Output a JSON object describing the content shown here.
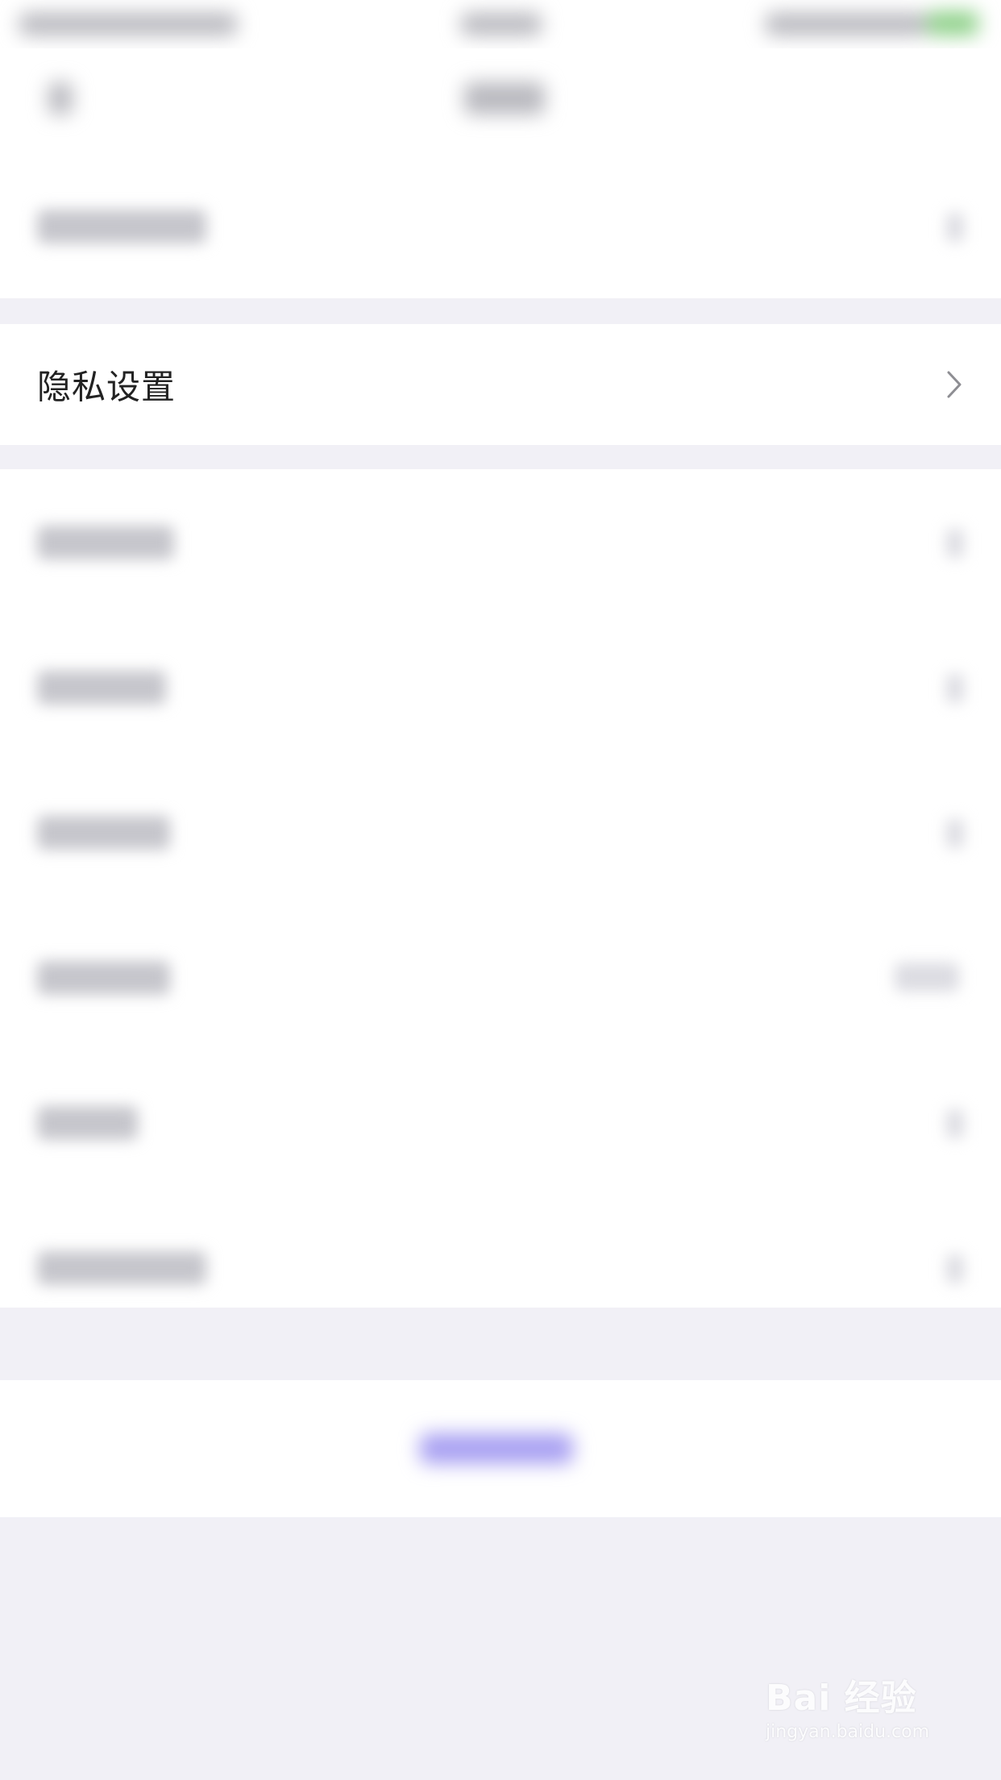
{
  "privacy_row": {
    "label": "隐私设置",
    "chevron_icon": "chevron-right-icon"
  },
  "watermark": {
    "brand": "Bai 经验",
    "url": "jingyan.baidu.com"
  },
  "colors": {
    "page_background": "#f1f0f6",
    "card_background": "#ffffff",
    "accent_logout": "#a9a1f2",
    "battery": "#8fd18a"
  }
}
